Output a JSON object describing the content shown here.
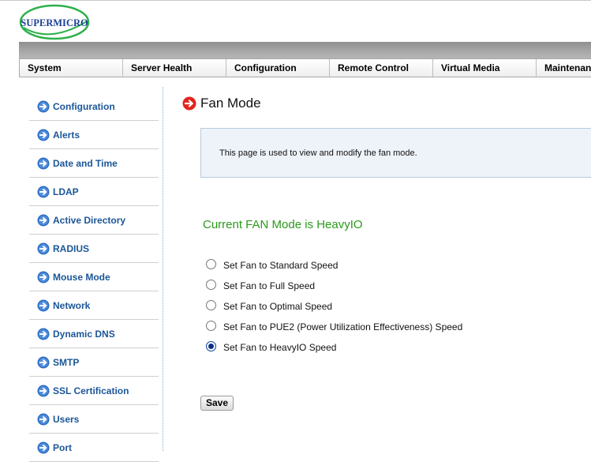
{
  "brand": {
    "logo_text": "SUPERMICRO"
  },
  "top_menu": [
    {
      "label": "System"
    },
    {
      "label": "Server Health"
    },
    {
      "label": "Configuration"
    },
    {
      "label": "Remote Control"
    },
    {
      "label": "Virtual Media"
    },
    {
      "label": "Maintenan"
    }
  ],
  "sidebar": {
    "icon": "arrow-right-circle-icon",
    "items": [
      {
        "label": "Configuration"
      },
      {
        "label": "Alerts"
      },
      {
        "label": "Date and Time"
      },
      {
        "label": "LDAP"
      },
      {
        "label": "Active Directory"
      },
      {
        "label": "RADIUS"
      },
      {
        "label": "Mouse Mode"
      },
      {
        "label": "Network"
      },
      {
        "label": "Dynamic DNS"
      },
      {
        "label": "SMTP"
      },
      {
        "label": "SSL Certification"
      },
      {
        "label": "Users"
      },
      {
        "label": "Port"
      }
    ]
  },
  "page": {
    "title": "Fan Mode",
    "description": "This page is used to view and modify the fan mode.",
    "current_mode": "Current FAN Mode is HeavyIO",
    "options": [
      {
        "label": "Set Fan to Standard Speed",
        "checked": false
      },
      {
        "label": "Set Fan to Full Speed",
        "checked": false
      },
      {
        "label": "Set Fan to Optimal Speed",
        "checked": false
      },
      {
        "label": "Set Fan to PUE2 (Power Utilization Effectiveness) Speed",
        "checked": false
      },
      {
        "label": "Set Fan to HeavyIO Speed",
        "checked": true
      }
    ],
    "save_label": "Save"
  },
  "colors": {
    "brand_blue": "#1b3f95",
    "brand_green": "#2eb04a",
    "sidebar_link": "#1b5698",
    "current_mode": "#2a9a1b",
    "title_icon": "#e0261c"
  }
}
